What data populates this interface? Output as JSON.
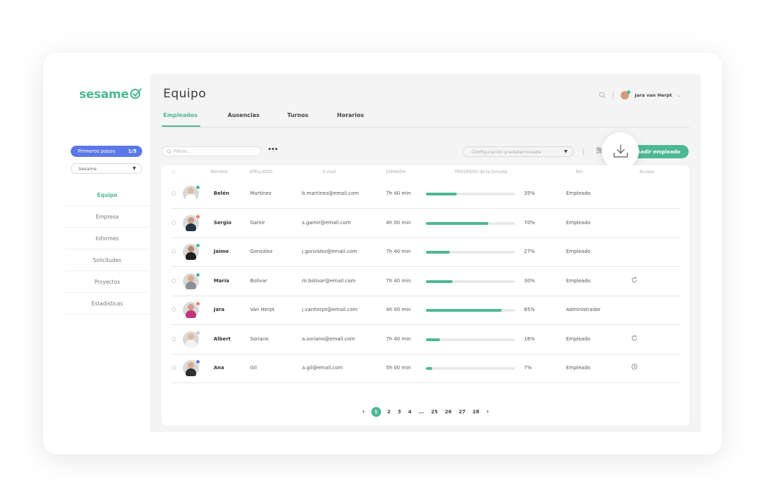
{
  "brand": {
    "logo_text": "sesame",
    "accent": "#4db894"
  },
  "sidebar": {
    "steps_label": "Primeros pasos",
    "steps_count": "1/5",
    "company_select": "Sesame",
    "items": [
      {
        "label": "Equipo",
        "active": true
      },
      {
        "label": "Empresa"
      },
      {
        "label": "Informes"
      },
      {
        "label": "Solicitudes"
      },
      {
        "label": "Proyectos"
      },
      {
        "label": "Estadísticas"
      }
    ]
  },
  "header": {
    "title": "Equipo",
    "user_name": "Jara van Herpt",
    "tabs": [
      {
        "label": "Empleados",
        "active": true
      },
      {
        "label": "Ausencias"
      },
      {
        "label": "Turnos"
      },
      {
        "label": "Horarios"
      }
    ]
  },
  "toolbar": {
    "filter_placeholder": "Filtrar...",
    "more_label": "•••",
    "config_value": "Configuración predeterminada",
    "add_label": "Añadir empleado"
  },
  "table": {
    "columns": {
      "nombre": "Nombre",
      "apellidos": "APELLIDOS",
      "email": "E-mail",
      "jornada": "JORNADA",
      "progreso": "PROGRESO de la jornada",
      "rol": "Rol",
      "acceso": "Acceso"
    },
    "rows": [
      {
        "name": "Belén",
        "surname": "Martínez",
        "email": "b.martinez@email.com",
        "hours": "7h 40 min",
        "progress": 35,
        "progress_label": "35%",
        "role": "Empleado",
        "access_icon": "",
        "status_color": "#4db894",
        "skin": "#e2b89a",
        "shirt": "#ffffff"
      },
      {
        "name": "Sergio",
        "surname": "Gamir",
        "email": "s.gamir@email.com",
        "hours": "4h 00 min",
        "progress": 70,
        "progress_label": "70%",
        "role": "Empleado",
        "access_icon": "",
        "status_color": "#f07b6a",
        "skin": "#c99a7c",
        "shirt": "#263245"
      },
      {
        "name": "Jaime",
        "surname": "González",
        "email": "j.gonzalez@email.com",
        "hours": "7h 40 min",
        "progress": 27,
        "progress_label": "27%",
        "role": "Empleado",
        "access_icon": "",
        "status_color": "#4db894",
        "skin": "#b7876a",
        "shirt": "#1f1f1f"
      },
      {
        "name": "María",
        "surname": "Bolívar",
        "email": "m.bolivar@email.com",
        "hours": "7h 40 min",
        "progress": 30,
        "progress_label": "30%",
        "role": "Empleado",
        "access_icon": "refresh-icon",
        "status_color": "#4db894",
        "skin": "#d8a98b",
        "shirt": "#8b8f96"
      },
      {
        "name": "Jara",
        "surname": "Van Herpt",
        "email": "j.vanherpt@email.com",
        "hours": "4h 00 min",
        "progress": 85,
        "progress_label": "85%",
        "role": "Administrador",
        "access_icon": "",
        "status_color": "#f07b6a",
        "skin": "#d09a84",
        "shirt": "#c2357a"
      },
      {
        "name": "Albert",
        "surname": "Soriano",
        "email": "a.soriano@email.com",
        "hours": "7h 40 min",
        "progress": 16,
        "progress_label": "16%",
        "role": "Empleado",
        "access_icon": "refresh-icon",
        "status_color": "#c8c8c8",
        "skin": "#e0b89c",
        "shirt": "#f2f2f2"
      },
      {
        "name": "Ana",
        "surname": "Gil",
        "email": "a.gil@email.com",
        "hours": "5h 00 min",
        "progress": 7,
        "progress_label": "7%",
        "role": "Empleado",
        "access_icon": "clock-icon",
        "status_color": "#5b78e6",
        "skin": "#d6a98a",
        "shirt": "#2f2f2f"
      }
    ]
  },
  "pagination": {
    "prev": "‹",
    "current": "1",
    "pages": [
      "2",
      "3",
      "4",
      "...",
      "25",
      "26",
      "27",
      "28"
    ],
    "next": "›"
  }
}
